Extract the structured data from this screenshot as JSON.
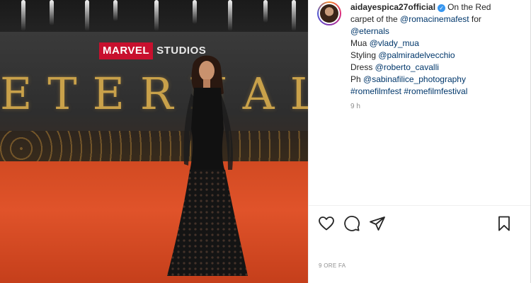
{
  "photo": {
    "logo_marvel": "MARVEL",
    "logo_studios": "STUDIOS",
    "backdrop_title": "ETERNALS"
  },
  "post": {
    "username": "aidayespica27official",
    "caption_lines": [
      {
        "text": "On the Red"
      },
      {
        "text": "carpet of the ",
        "mention": "@romacinemafest",
        "after": " for"
      },
      {
        "mention": "@eternals"
      },
      {
        "text": "Mua ",
        "mention": "@vlady_mua"
      },
      {
        "text": "Styling ",
        "mention": "@palmiradelvecchio"
      },
      {
        "text": "Dress ",
        "mention": "@roberto_cavalli"
      },
      {
        "text": "Ph ",
        "mention": "@sabinafilice_photography"
      },
      {
        "mention": "#romefilmfest #romefilmfestival"
      }
    ],
    "comment_time": "9 h",
    "post_time": "9 ORE FA"
  },
  "actions": {
    "like_icon": "heart-icon",
    "comment_icon": "comment-icon",
    "share_icon": "paper-plane-icon",
    "save_icon": "bookmark-icon"
  },
  "colors": {
    "mention": "#00376b",
    "verified": "#3897f0",
    "muted": "#8e8e8e",
    "carpet": "#d24a22"
  }
}
